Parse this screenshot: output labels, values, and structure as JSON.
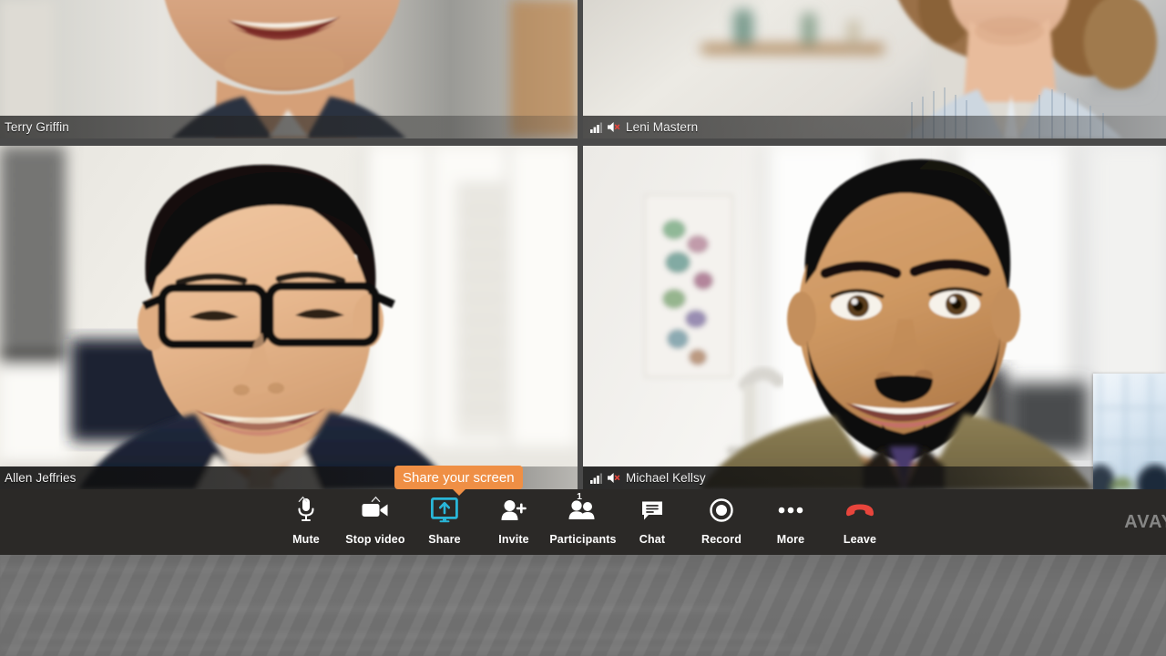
{
  "app": {
    "brand": "AVAYA",
    "brand_visible_text": "AVAY"
  },
  "tooltip": {
    "text": "Share your screen",
    "color": "#ef8f45",
    "target": "share-button"
  },
  "video_grid": {
    "layout": "2x2",
    "tiles": [
      {
        "id": "tile-top-left",
        "name": "Terry Griffin",
        "position": "top-left",
        "has_signal_icon": false,
        "has_speaker_muted_icon": false,
        "cropped": true
      },
      {
        "id": "tile-top-right",
        "name": "Leni Mastern",
        "position": "top-right",
        "has_signal_icon": true,
        "has_speaker_muted_icon": true,
        "cropped": true
      },
      {
        "id": "tile-bottom-left",
        "name": "Allen Jeffries",
        "position": "bottom-left",
        "has_signal_icon": false,
        "has_speaker_muted_icon": false,
        "cropped": false
      },
      {
        "id": "tile-bottom-right",
        "name": "Michael Kellsy",
        "position": "bottom-right",
        "has_signal_icon": true,
        "has_speaker_muted_icon": true,
        "cropped": false
      }
    ]
  },
  "toolbar": {
    "background": "#2b2927",
    "buttons": [
      {
        "id": "mute",
        "label": "Mute",
        "icon": "microphone-icon",
        "caret": true,
        "badge": null,
        "active": false
      },
      {
        "id": "stop-video",
        "label": "Stop video",
        "icon": "video-camera-icon",
        "caret": true,
        "badge": null,
        "active": false
      },
      {
        "id": "share",
        "label": "Share",
        "icon": "screen-share-icon",
        "caret": false,
        "badge": null,
        "active": true,
        "accent": "#29b6d8"
      },
      {
        "id": "invite",
        "label": "Invite",
        "icon": "person-add-icon",
        "caret": false,
        "badge": null,
        "active": false
      },
      {
        "id": "participants",
        "label": "Participants",
        "icon": "people-icon",
        "caret": false,
        "badge": "1",
        "active": false
      },
      {
        "id": "chat",
        "label": "Chat",
        "icon": "chat-bubble-icon",
        "caret": false,
        "badge": null,
        "active": false
      },
      {
        "id": "record",
        "label": "Record",
        "icon": "record-circle-icon",
        "caret": false,
        "badge": null,
        "active": false
      },
      {
        "id": "more",
        "label": "More",
        "icon": "ellipsis-icon",
        "caret": false,
        "badge": null,
        "active": false
      },
      {
        "id": "leave",
        "label": "Leave",
        "icon": "phone-hangup-icon",
        "caret": false,
        "badge": null,
        "active": false,
        "accent": "#e8453c"
      }
    ]
  }
}
